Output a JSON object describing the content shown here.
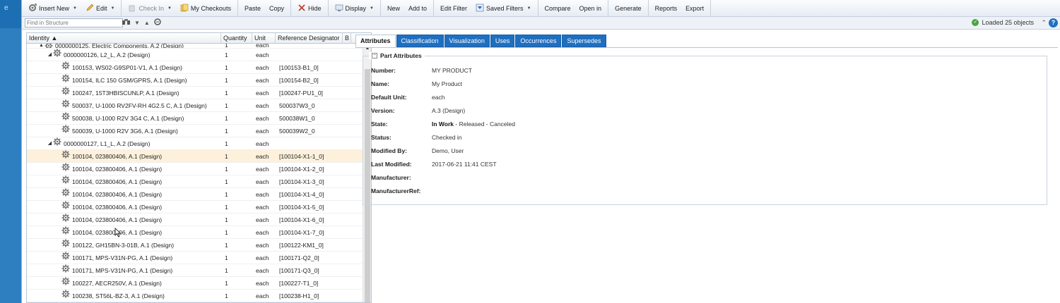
{
  "leftbar": {
    "glyph": "e"
  },
  "toolbar": {
    "groups": [
      [
        {
          "label": "Insert New",
          "icon": "insert-new-icon",
          "caret": true
        },
        {
          "label": "Edit",
          "icon": "pencil-icon",
          "caret": true
        }
      ],
      [
        {
          "label": "Check In",
          "icon": "check-in-icon",
          "caret": true,
          "disabled": true
        },
        {
          "label": "My Checkouts",
          "icon": "checkouts-icon"
        }
      ],
      [
        {
          "label": "Paste"
        },
        {
          "label": "Copy"
        }
      ],
      [
        {
          "label": "Hide",
          "icon": "hide-icon"
        }
      ],
      [
        {
          "label": "Display",
          "icon": "display-icon",
          "caret": true
        }
      ],
      [
        {
          "label": "New"
        },
        {
          "label": "Add to"
        }
      ],
      [
        {
          "label": "Edit Filter"
        },
        {
          "label": "Saved Filters",
          "icon": "saved-filters-icon",
          "caret": true
        }
      ],
      [
        {
          "label": "Compare"
        },
        {
          "label": "Open in"
        }
      ],
      [
        {
          "label": "Generate"
        }
      ],
      [
        {
          "label": "Reports"
        },
        {
          "label": "Export"
        }
      ]
    ]
  },
  "search": {
    "placeholder": "Find in Structure",
    "value": ""
  },
  "status": {
    "loaded": "Loaded 25 objects"
  },
  "tree": {
    "columns": {
      "identity": "Identity ▲",
      "quantity": "Quantity",
      "unit": "Unit",
      "refdes": "Reference Designator",
      "extra": "B"
    },
    "rows": [
      {
        "level": 0,
        "expander": "▲",
        "name": "0000000125, Electric Components, A.2 (Design)",
        "qty": "1",
        "unit": "each",
        "ref": "",
        "partial": true
      },
      {
        "level": 1,
        "expander": "◢",
        "name": "0000000126, L2_L, A.2 (Design)",
        "qty": "1",
        "unit": "each",
        "ref": ""
      },
      {
        "level": 2,
        "expander": "",
        "name": "100153, WS02-G9SP01-V1, A.1 (Design)",
        "qty": "1",
        "unit": "each",
        "ref": "[100153-B1_0]"
      },
      {
        "level": 2,
        "expander": "",
        "name": "100154, ILC 150 GSM/GPRS, A.1 (Design)",
        "qty": "1",
        "unit": "each",
        "ref": "[100154-B2_0]"
      },
      {
        "level": 2,
        "expander": "",
        "name": "100247, 15T3HBISCUNLP, A.1 (Design)",
        "qty": "1",
        "unit": "each",
        "ref": "[100247-PU1_0]"
      },
      {
        "level": 2,
        "expander": "",
        "name": "500037, U-1000 RV2FV-RH 4G2.5 C, A.1 (Design)",
        "qty": "1",
        "unit": "each",
        "ref": "500037W3_0"
      },
      {
        "level": 2,
        "expander": "",
        "name": "500038, U-1000 R2V 3G4 C, A.1 (Design)",
        "qty": "1",
        "unit": "each",
        "ref": "500038W1_0"
      },
      {
        "level": 2,
        "expander": "",
        "name": "500039, U-1000 R2V 3G6, A.1 (Design)",
        "qty": "1",
        "unit": "each",
        "ref": "500039W2_0"
      },
      {
        "level": 1,
        "expander": "◢",
        "name": "0000000127, L1_L, A.2 (Design)",
        "qty": "1",
        "unit": "each",
        "ref": ""
      },
      {
        "level": 2,
        "expander": "",
        "name": "100104, 023800406, A.1 (Design)",
        "qty": "1",
        "unit": "each",
        "ref": "[100104-X1-1_0]",
        "selected": true
      },
      {
        "level": 2,
        "expander": "",
        "name": "100104, 023800406, A.1 (Design)",
        "qty": "1",
        "unit": "each",
        "ref": "[100104-X1-2_0]"
      },
      {
        "level": 2,
        "expander": "",
        "name": "100104, 023800406, A.1 (Design)",
        "qty": "1",
        "unit": "each",
        "ref": "[100104-X1-3_0]"
      },
      {
        "level": 2,
        "expander": "",
        "name": "100104, 023800406, A.1 (Design)",
        "qty": "1",
        "unit": "each",
        "ref": "[100104-X1-4_0]"
      },
      {
        "level": 2,
        "expander": "",
        "name": "100104, 023800406, A.1 (Design)",
        "qty": "1",
        "unit": "each",
        "ref": "[100104-X1-5_0]"
      },
      {
        "level": 2,
        "expander": "",
        "name": "100104, 023800406, A.1 (Design)",
        "qty": "1",
        "unit": "each",
        "ref": "[100104-X1-6_0]"
      },
      {
        "level": 2,
        "expander": "",
        "name": "100104, 023800406, A.1 (Design)",
        "qty": "1",
        "unit": "each",
        "ref": "[100104-X1-7_0]"
      },
      {
        "level": 2,
        "expander": "",
        "name": "100122, GH15BN-3-01B, A.1 (Design)",
        "qty": "1",
        "unit": "each",
        "ref": "[100122-KM1_0]"
      },
      {
        "level": 2,
        "expander": "",
        "name": "100171, MPS-V31N-PG, A.1 (Design)",
        "qty": "1",
        "unit": "each",
        "ref": "[100171-Q2_0]"
      },
      {
        "level": 2,
        "expander": "",
        "name": "100171, MPS-V31N-PG, A.1 (Design)",
        "qty": "1",
        "unit": "each",
        "ref": "[100171-Q3_0]"
      },
      {
        "level": 2,
        "expander": "",
        "name": "100227, AECR250V, A.1 (Design)",
        "qty": "1",
        "unit": "each",
        "ref": "[100227-T1_0]"
      },
      {
        "level": 2,
        "expander": "",
        "name": "100238, ST56L-BZ-3, A.1 (Design)",
        "qty": "1",
        "unit": "each",
        "ref": "[100238-H1_0]"
      }
    ]
  },
  "details": {
    "tabs": [
      {
        "label": "Attributes",
        "active": true
      },
      {
        "label": "Classification"
      },
      {
        "label": "Visualization"
      },
      {
        "label": "Uses"
      },
      {
        "label": "Occurrences"
      },
      {
        "label": "Supersedes"
      }
    ],
    "group_title": "Part Attributes",
    "attributes": [
      {
        "label": "Number:",
        "value": "MY PRODUCT"
      },
      {
        "label": "Name:",
        "value": "My Product"
      },
      {
        "label": "Default Unit:",
        "value": "each"
      },
      {
        "label": "Version:",
        "value": "A.3 (Design)"
      },
      {
        "label": "State:",
        "value_bold": "In Work",
        "value": " - Released - Canceled"
      },
      {
        "label": "Status:",
        "value": "Checked in"
      },
      {
        "label": "Modified By:",
        "value": "Demo, User",
        "link": true
      },
      {
        "label": "Last Modified:",
        "value": "2017-06-21 11:41 CEST"
      },
      {
        "label": "Manufacturer:",
        "value": ""
      },
      {
        "label": "ManufacturerRef:",
        "value": ""
      }
    ]
  },
  "colors": {
    "accent": "#1f6fc0",
    "selection": "#fdf1dc",
    "ok": "#4aa53d"
  }
}
